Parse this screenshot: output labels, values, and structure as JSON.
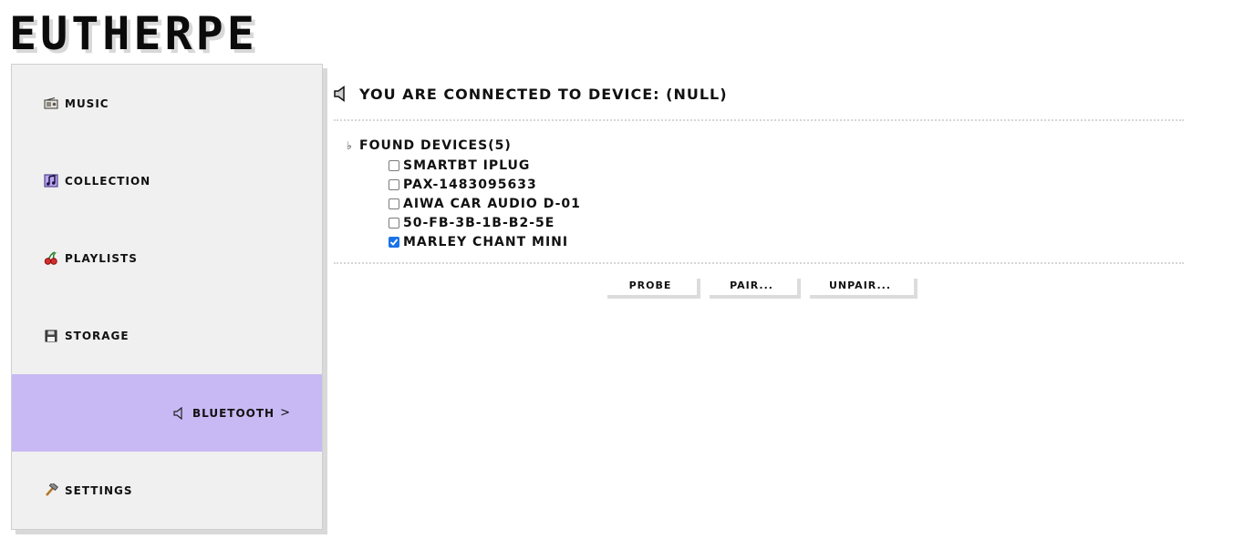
{
  "app": {
    "logo": "EUTHERPE"
  },
  "sidebar": {
    "items": [
      {
        "label": "MUSIC",
        "icon": "radio-icon"
      },
      {
        "label": "COLLECTION",
        "icon": "music-notes-icon"
      },
      {
        "label": "PLAYLISTS",
        "icon": "cherries-icon"
      },
      {
        "label": "STORAGE",
        "icon": "floppy-disk-icon"
      },
      {
        "label": "BLUETOOTH",
        "icon": "speaker-icon",
        "active": true,
        "suffix": ">"
      },
      {
        "label": "SETTINGS",
        "icon": "hammer-icon"
      }
    ],
    "active_color": "#c8b9f4"
  },
  "main": {
    "status_text": "YOU ARE CONNECTED TO DEVICE: (NULL)",
    "devices_header": "FOUND DEVICES(5)",
    "flat_symbol": "♭",
    "devices": [
      {
        "name": "SMARTBT IPLUG",
        "checked": false
      },
      {
        "name": "PAX-1483095633",
        "checked": false
      },
      {
        "name": "AIWA CAR AUDIO D-01",
        "checked": false
      },
      {
        "name": "50-FB-3B-1B-B2-5E",
        "checked": false
      },
      {
        "name": "MARLEY CHANT MINI",
        "checked": true
      }
    ],
    "buttons": {
      "probe": "PROBE",
      "pair": "PAIR...",
      "unpair": "UNPAIR..."
    }
  }
}
